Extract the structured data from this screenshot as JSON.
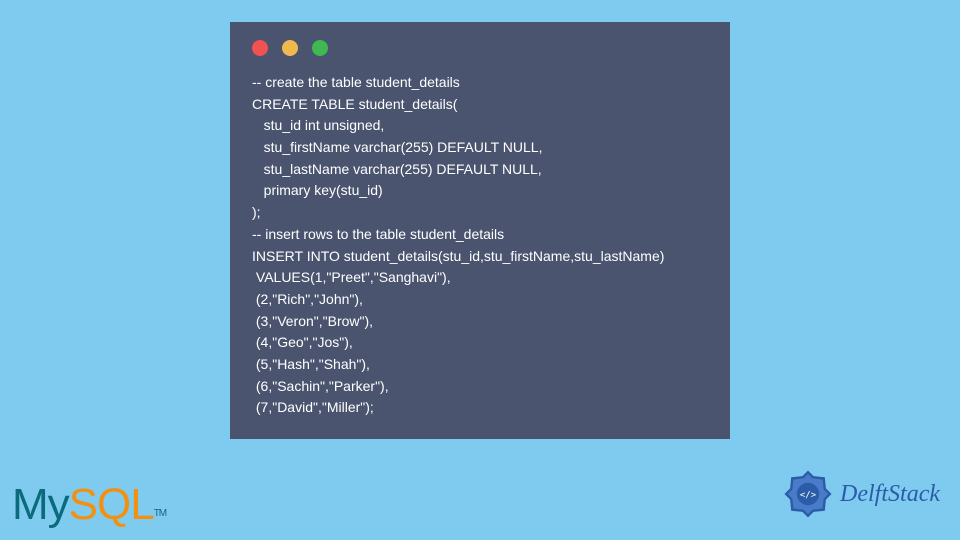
{
  "code": {
    "lines": [
      "-- create the table student_details",
      "CREATE TABLE student_details(",
      "   stu_id int unsigned,",
      "   stu_firstName varchar(255) DEFAULT NULL,",
      "   stu_lastName varchar(255) DEFAULT NULL,",
      "   primary key(stu_id)",
      ");",
      "-- insert rows to the table student_details",
      "INSERT INTO student_details(stu_id,stu_firstName,stu_lastName)",
      " VALUES(1,\"Preet\",\"Sanghavi\"),",
      " (2,\"Rich\",\"John\"),",
      " (3,\"Veron\",\"Brow\"),",
      " (4,\"Geo\",\"Jos\"),",
      " (5,\"Hash\",\"Shah\"),",
      " (6,\"Sachin\",\"Parker\"),",
      " (7,\"David\",\"Miller\");"
    ]
  },
  "logos": {
    "mysql_my": "My",
    "mysql_sql": "SQL",
    "mysql_tm": "TM",
    "delft": "DelftStack"
  }
}
